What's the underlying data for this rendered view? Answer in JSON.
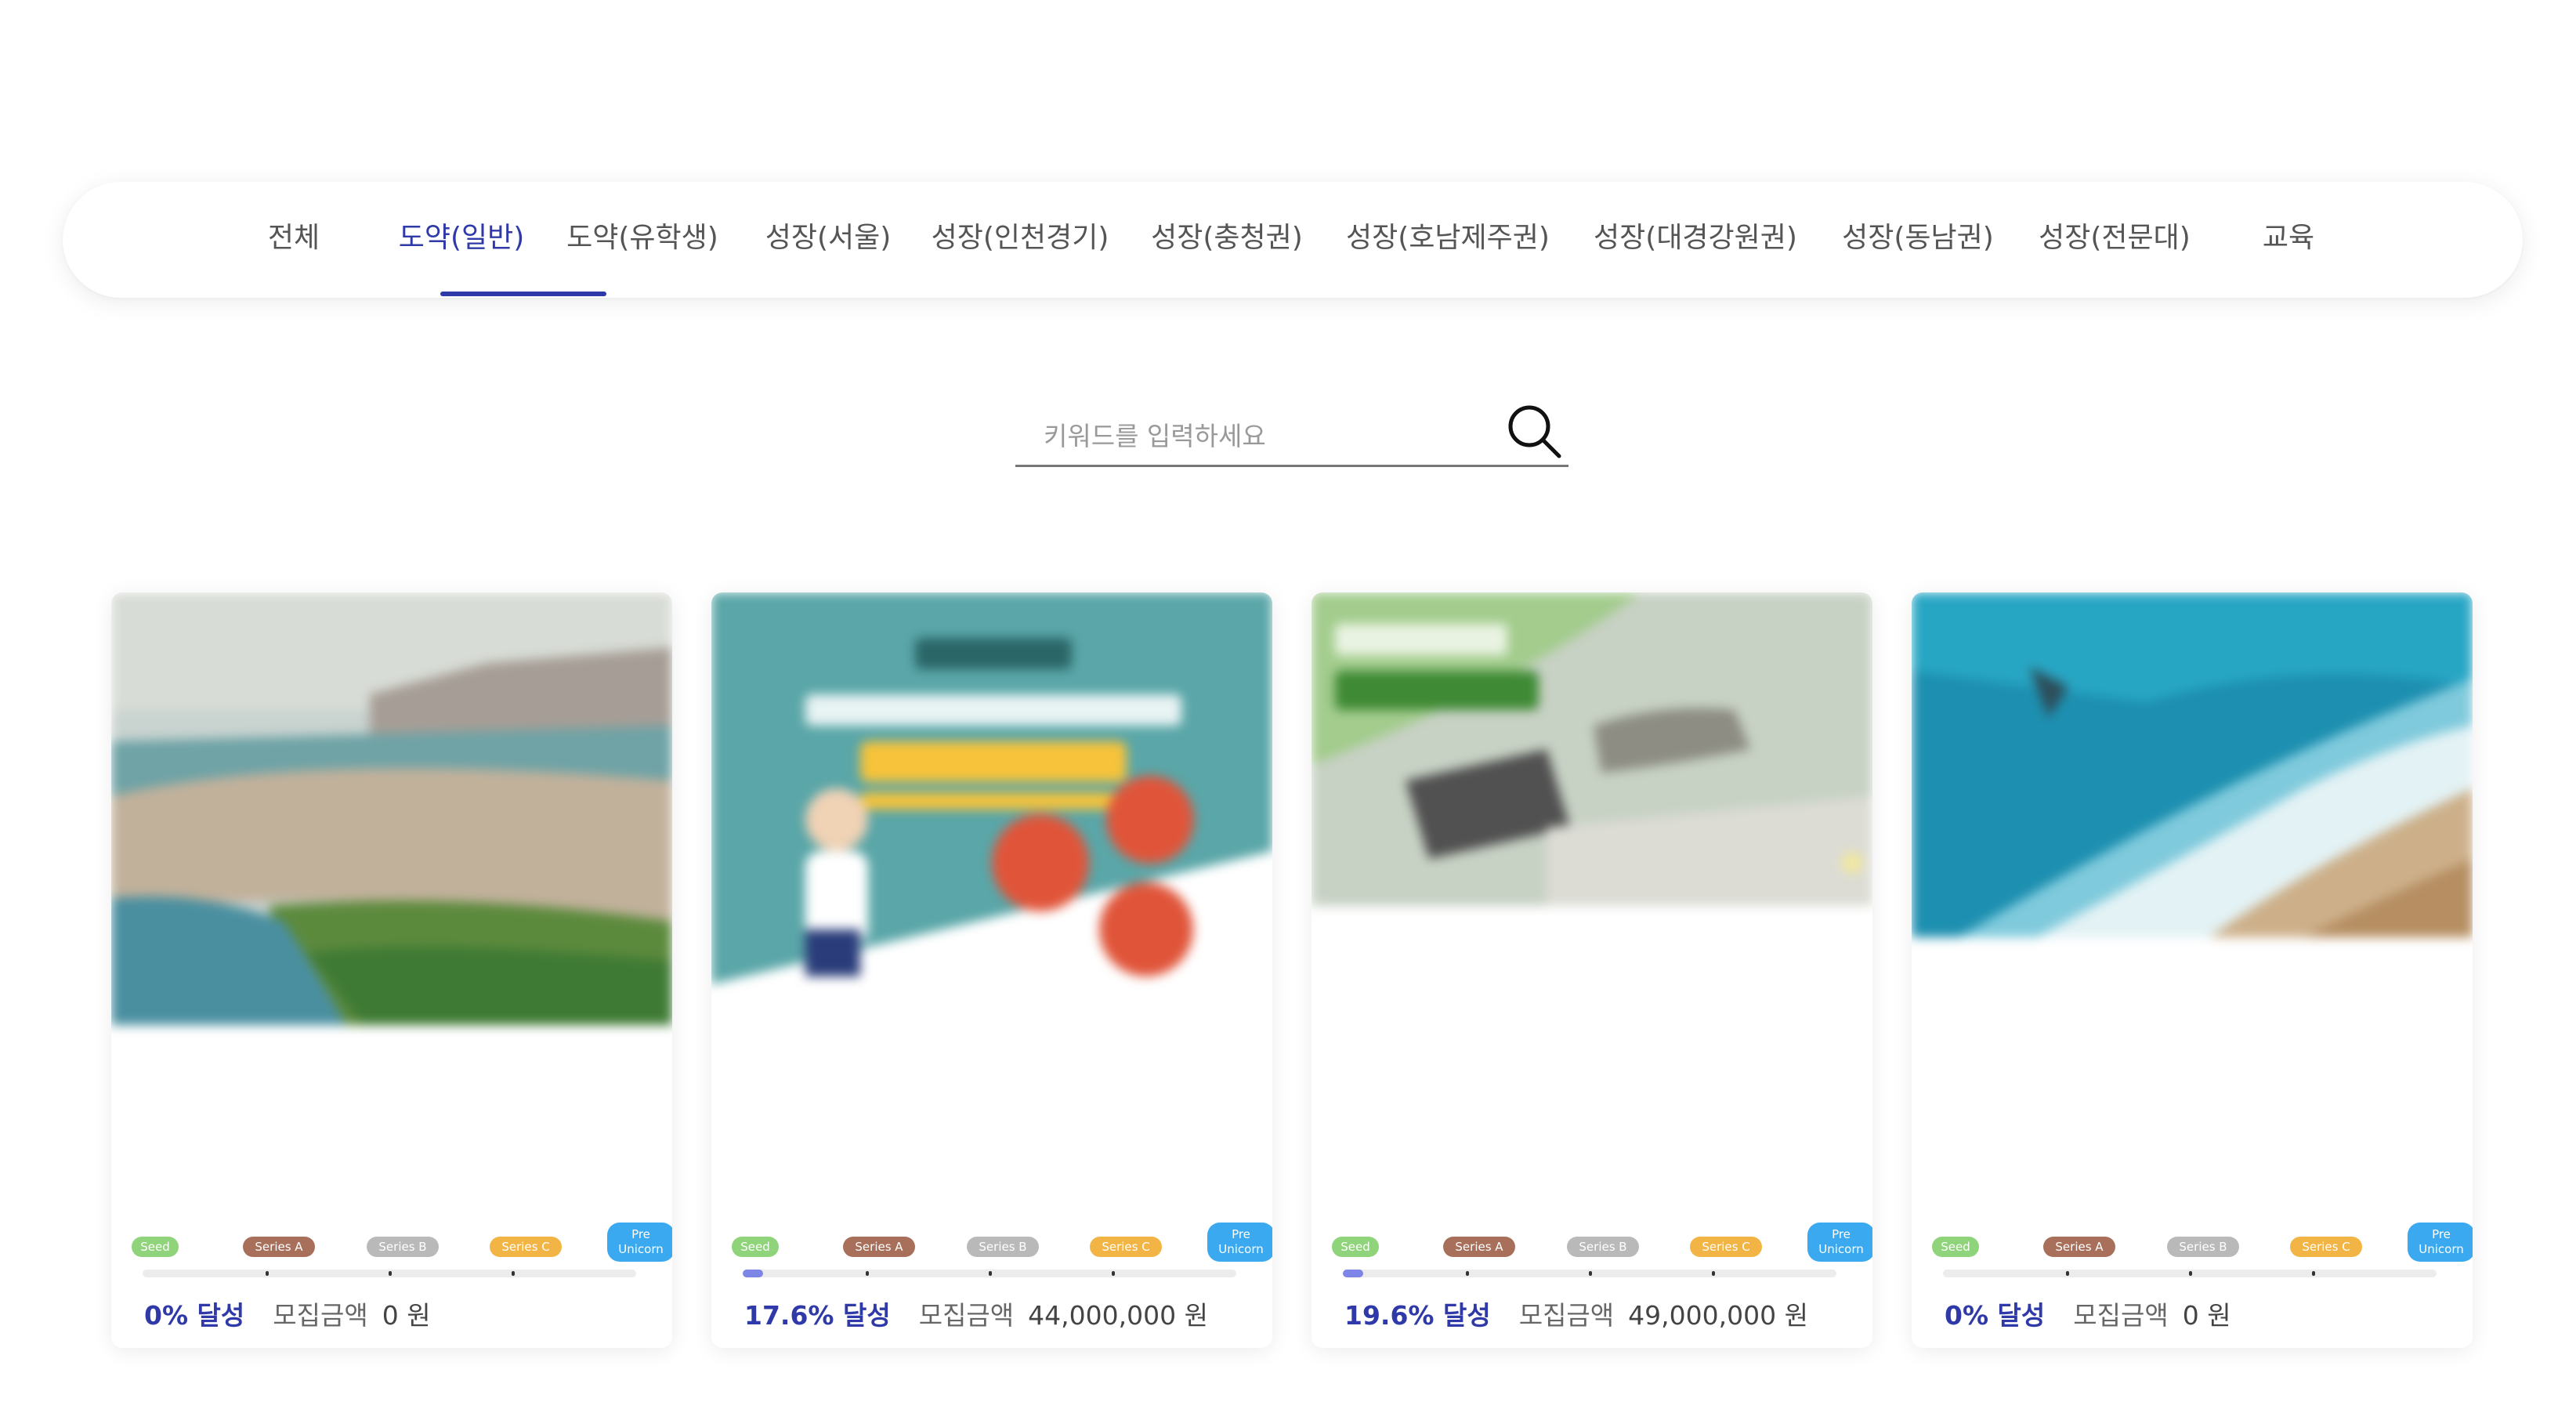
{
  "tabs": [
    {
      "label": "전체",
      "active": false
    },
    {
      "label": "도약(일반)",
      "active": true
    },
    {
      "label": "도약(유학생)",
      "active": false
    },
    {
      "label": "성장(서울)",
      "active": false
    },
    {
      "label": "성장(인천경기)",
      "active": false
    },
    {
      "label": "성장(충청권)",
      "active": false
    },
    {
      "label": "성장(호남제주권)",
      "active": false
    },
    {
      "label": "성장(대경강원권)",
      "active": false
    },
    {
      "label": "성장(동남권)",
      "active": false
    },
    {
      "label": "성장(전문대)",
      "active": false
    },
    {
      "label": "교육",
      "active": false
    }
  ],
  "search": {
    "placeholder": "키워드를 입력하세요",
    "value": ""
  },
  "stages": [
    "Seed",
    "Series A",
    "Series B",
    "Series C",
    "Pre Unicorn"
  ],
  "stage_colors": [
    "#8fd47a",
    "#a8705a",
    "#b9b9b9",
    "#f2b545",
    "#3aa9f0"
  ],
  "accent": "#2f3aa8",
  "cards": [
    {
      "progress": 0.0,
      "progress_label": "0% 달성",
      "amount_label": "모집금액",
      "amount": "0 원",
      "image": "lake-hills-photo"
    },
    {
      "progress": 0.176,
      "progress_label": "17.6% 달성",
      "amount_label": "모집금액",
      "amount": "44,000,000 원",
      "image": "promo-banner-illustration"
    },
    {
      "progress": 0.196,
      "progress_label": "19.6% 달성",
      "amount_label": "모집금액",
      "amount": "49,000,000 원",
      "image": "green-product-photo"
    },
    {
      "progress": 0.0,
      "progress_label": "0% 달성",
      "amount_label": "모집금액",
      "amount": "0 원",
      "image": "ocean-beach-aerial-photo"
    }
  ]
}
